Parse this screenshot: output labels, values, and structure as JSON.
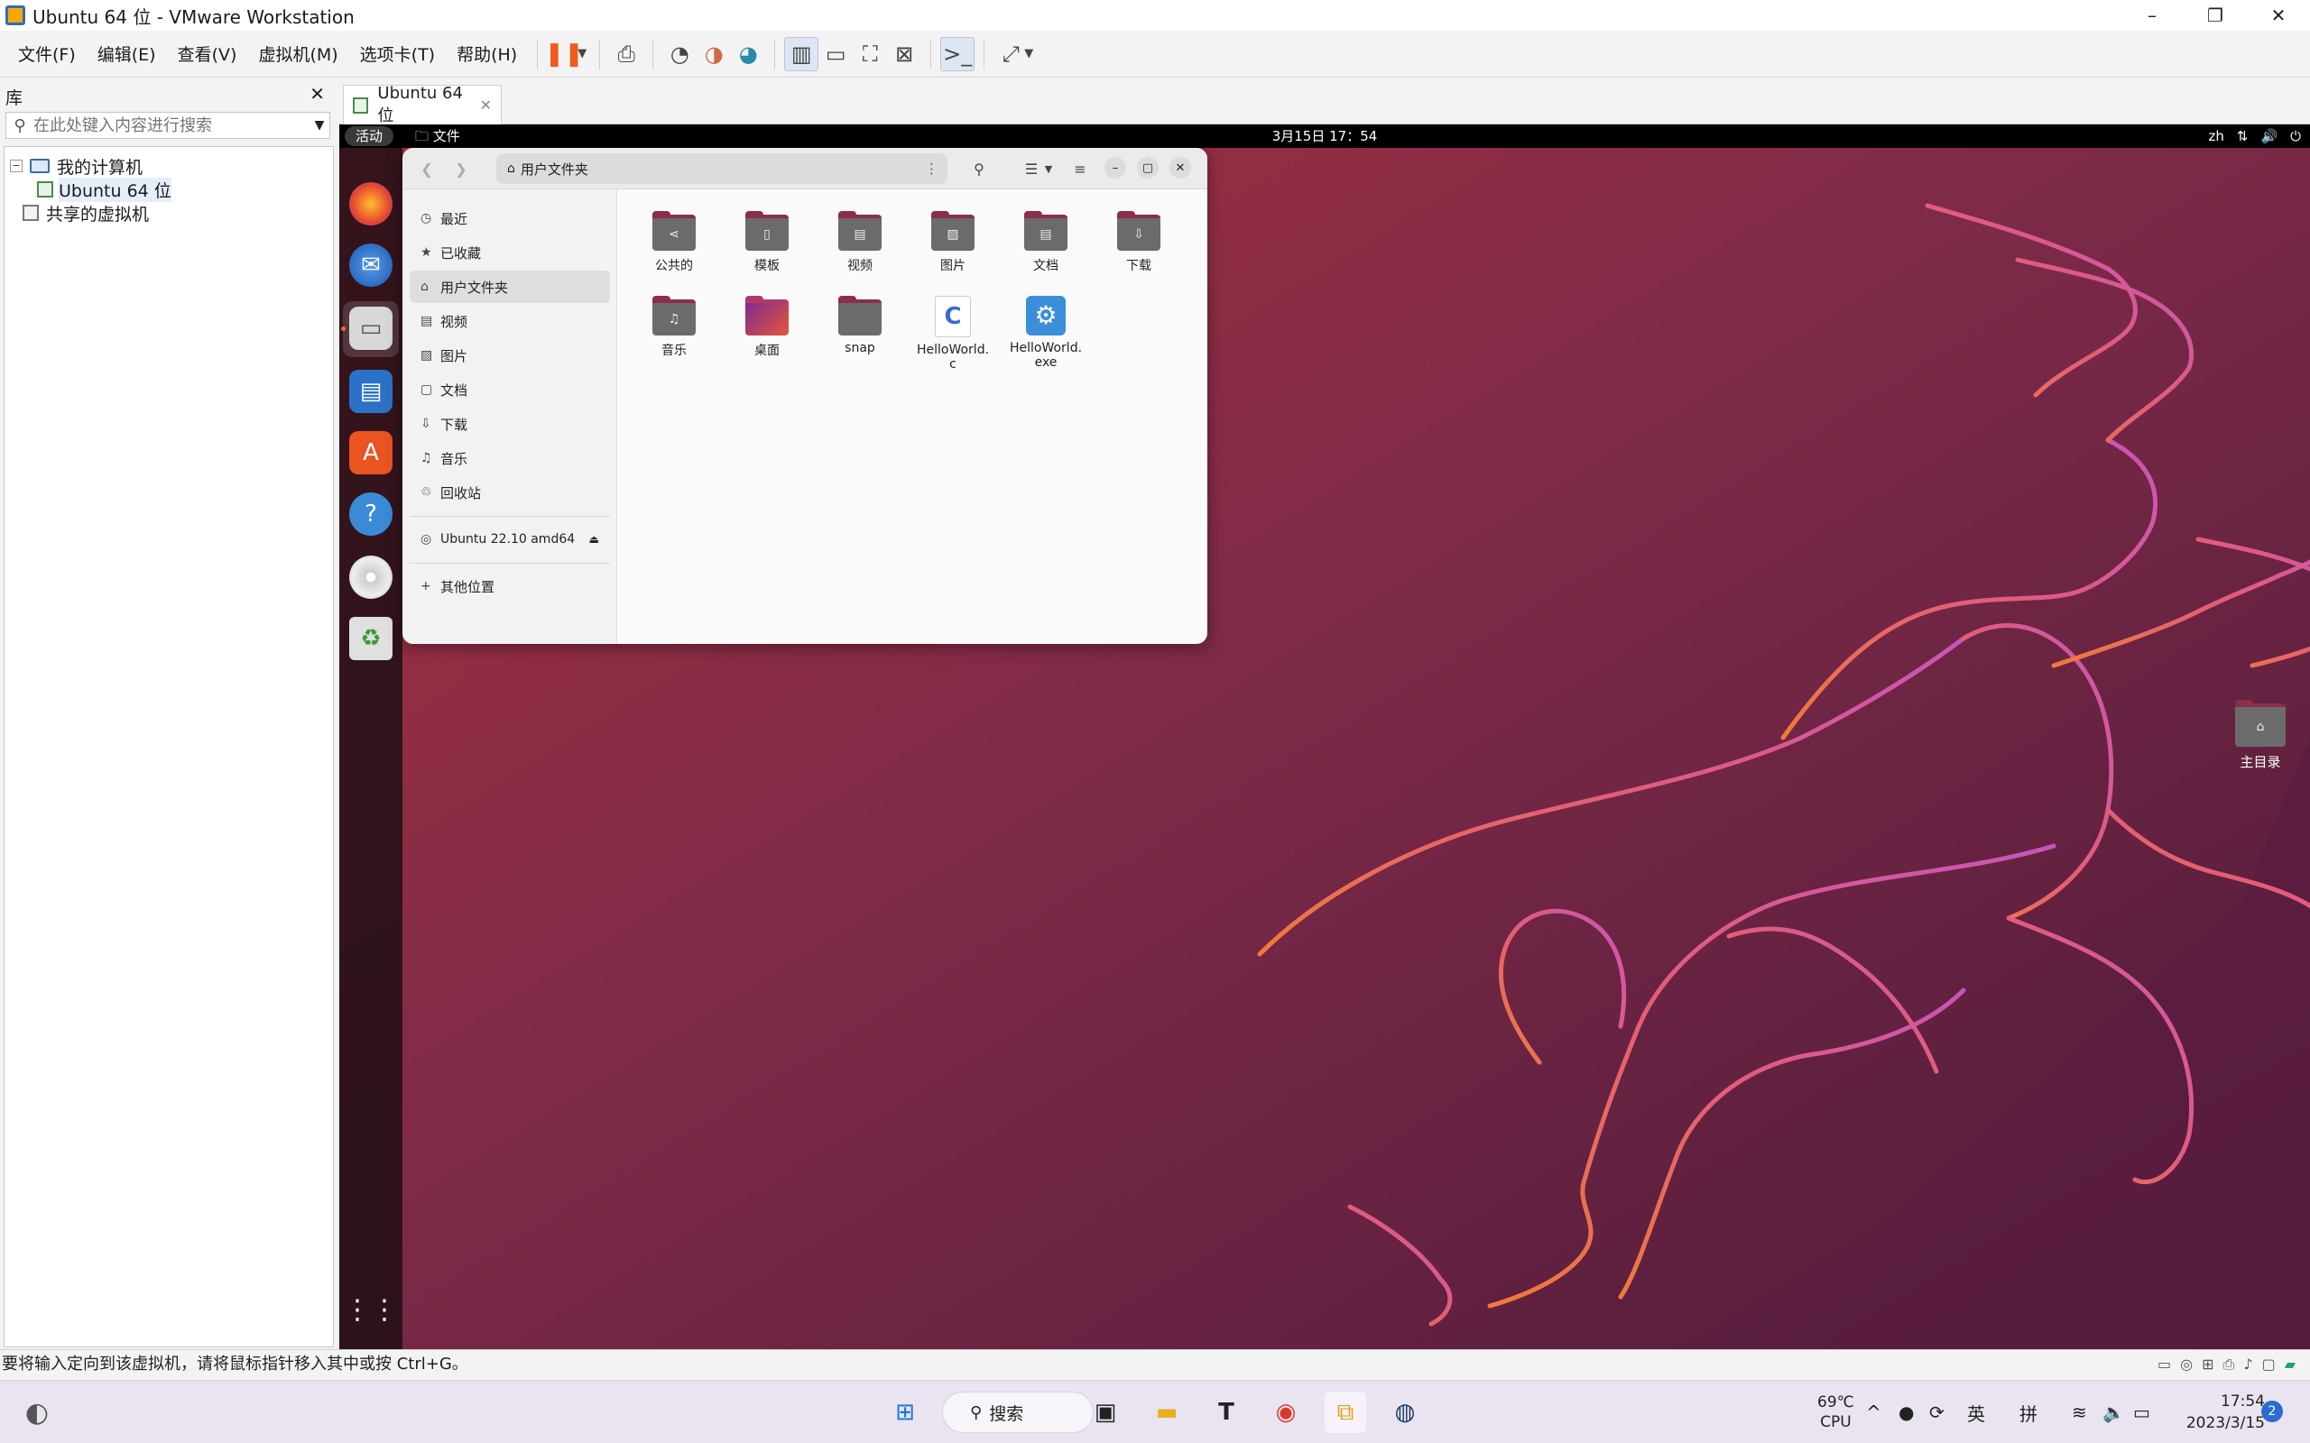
{
  "window": {
    "title": "Ubuntu 64 位 - VMware Workstation",
    "minimize": "–",
    "maximize": "❐",
    "close": "✕"
  },
  "menubar": {
    "items": [
      "文件(F)",
      "编辑(E)",
      "查看(V)",
      "虚拟机(M)",
      "选项卡(T)",
      "帮助(H)"
    ]
  },
  "toolbar": {
    "pause_icon": "pause-icon",
    "send_keys_icon": "send-ctrl-alt-del-icon",
    "snapshot_icons": [
      "snapshot-take-icon",
      "snapshot-revert-icon",
      "snapshot-manager-icon"
    ],
    "view_icons": [
      "library-view-icon",
      "thumbnail-view-icon",
      "fullscreen-icon",
      "unity-icon"
    ],
    "console_icon": "console-icon",
    "stretch_icon": "stretch-icon"
  },
  "library": {
    "title": "库",
    "close": "✕",
    "search_placeholder": "在此处键入内容进行搜索",
    "tree": [
      {
        "label": "我的计算机",
        "expander": "−"
      },
      {
        "label": "Ubuntu 64 位"
      },
      {
        "label": "共享的虚拟机"
      }
    ]
  },
  "vm_tab": {
    "label": "Ubuntu 64 位",
    "close": "✕"
  },
  "ubuntu": {
    "topbar": {
      "activities": "活动",
      "app_menu": "文件",
      "clock": "3月15日 17：54",
      "lang": "zh",
      "tray_icons": [
        "network-icon",
        "volume-icon",
        "power-icon"
      ]
    },
    "dock": [
      "firefox-icon",
      "thunderbird-icon",
      "files-icon",
      "writer-icon",
      "app-center-icon",
      "help-icon",
      "disc-icon",
      "trash-icon",
      "app-grid-icon"
    ],
    "files": {
      "path": "用户文件夹",
      "sidebar": [
        {
          "label": "最近",
          "icon": "◷"
        },
        {
          "label": "已收藏",
          "icon": "★"
        },
        {
          "label": "用户文件夹",
          "icon": "⌂"
        },
        {
          "label": "视频",
          "icon": "▤"
        },
        {
          "label": "图片",
          "icon": "▨"
        },
        {
          "label": "文档",
          "icon": "▢"
        },
        {
          "label": "下载",
          "icon": "⇩"
        },
        {
          "label": "音乐",
          "icon": "♫"
        },
        {
          "label": "回收站",
          "icon": "♲"
        },
        {
          "label": "Ubuntu 22.10 amd64",
          "icon": "◎",
          "eject": "⏏"
        },
        {
          "label": "其他位置",
          "icon": "+"
        }
      ],
      "items": [
        {
          "name": "公共的",
          "glyph": "⋖"
        },
        {
          "name": "模板",
          "glyph": "▯"
        },
        {
          "name": "视频",
          "glyph": "▤"
        },
        {
          "name": "图片",
          "glyph": "▨"
        },
        {
          "name": "文档",
          "glyph": "▤"
        },
        {
          "name": "下载",
          "glyph": "⇩"
        },
        {
          "name": "音乐",
          "glyph": "♫"
        },
        {
          "name": "桌面",
          "glyph": ""
        },
        {
          "name": "snap",
          "glyph": ""
        },
        {
          "name": "HelloWorld.\nc",
          "glyph": "C"
        },
        {
          "name": "HelloWorld.\nexe",
          "glyph": "⚙"
        }
      ]
    },
    "desktop_icon": {
      "label": "主目录"
    }
  },
  "statusbar": {
    "message": "要将输入定向到该虚拟机，请将鼠标指针移入其中或按 Ctrl+G。"
  },
  "taskbar": {
    "search": "搜索",
    "temp": "69℃",
    "cpu": "CPU",
    "ime_en": "英",
    "ime_pin": "拼",
    "time": "17:54",
    "date": "2023/3/15",
    "notifications": "2"
  },
  "colors": {
    "accent_orange": "#e95420",
    "vmware_pause": "#f05a1a",
    "ubuntu_bg": "#7a2a4e"
  }
}
